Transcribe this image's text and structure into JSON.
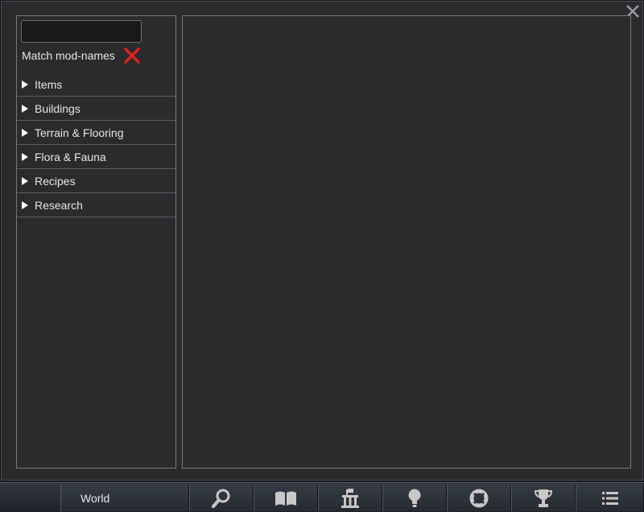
{
  "search": {
    "value": "",
    "placeholder": ""
  },
  "match_mod_names": {
    "label": "Match mod-names",
    "enabled": false,
    "toggle_icon": "red-x-icon",
    "toggle_color": "#e0221e"
  },
  "categories": [
    {
      "label": "Items",
      "icon": "expand-arrow-icon"
    },
    {
      "label": "Buildings",
      "icon": "expand-arrow-icon"
    },
    {
      "label": "Terrain & Flooring",
      "icon": "expand-arrow-icon"
    },
    {
      "label": "Flora & Fauna",
      "icon": "expand-arrow-icon"
    },
    {
      "label": "Recipes",
      "icon": "expand-arrow-icon"
    },
    {
      "label": "Research",
      "icon": "expand-arrow-icon"
    }
  ],
  "window": {
    "close_icon": "close-icon"
  },
  "bottom_bar": {
    "world_label": "World",
    "buttons": [
      {
        "icon": "magnifier-icon"
      },
      {
        "icon": "book-icon"
      },
      {
        "icon": "architect-icon"
      },
      {
        "icon": "lightbulb-icon"
      },
      {
        "icon": "lifebuoy-icon"
      },
      {
        "icon": "trophy-icon"
      },
      {
        "icon": "menu-list-icon"
      }
    ]
  },
  "colors": {
    "window_bg": "#2a2b2d",
    "panel_border": "#77797d",
    "text": "#e6e6e6",
    "icon": "#c8c8c8"
  }
}
